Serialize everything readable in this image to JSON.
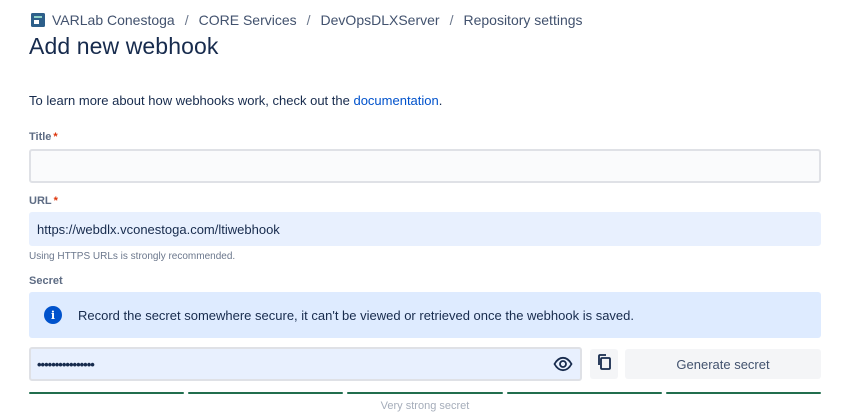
{
  "breadcrumb": {
    "items": [
      "VARLab Conestoga",
      "CORE Services",
      "DevOpsDLXServer",
      "Repository settings"
    ],
    "separator": "/"
  },
  "page": {
    "title": "Add new webhook"
  },
  "intro": {
    "text": "To learn more about how webhooks work, check out the ",
    "link": "documentation",
    "suffix": "."
  },
  "form": {
    "title": {
      "label": "Title",
      "required_mark": "*",
      "value": ""
    },
    "url": {
      "label": "URL",
      "required_mark": "*",
      "value": "https://webdlx.vconestoga.com/ltiwebhook",
      "helper": "Using HTTPS URLs is strongly recommended."
    },
    "secret": {
      "label": "Secret",
      "info": "Record the secret somewhere secure, it can't be viewed or retrieved once the webhook is saved.",
      "masked_value": "••••••••••••••••",
      "generate_label": "Generate secret",
      "strength_label": "Very strong secret",
      "strength_segments": 5
    }
  },
  "colors": {
    "link": "#0052cc",
    "info_bg": "#deebff",
    "strength": "#216e4e",
    "required": "#de350b"
  },
  "icons": [
    "repo-logo-icon",
    "info-icon",
    "eye-icon",
    "copy-icon"
  ]
}
